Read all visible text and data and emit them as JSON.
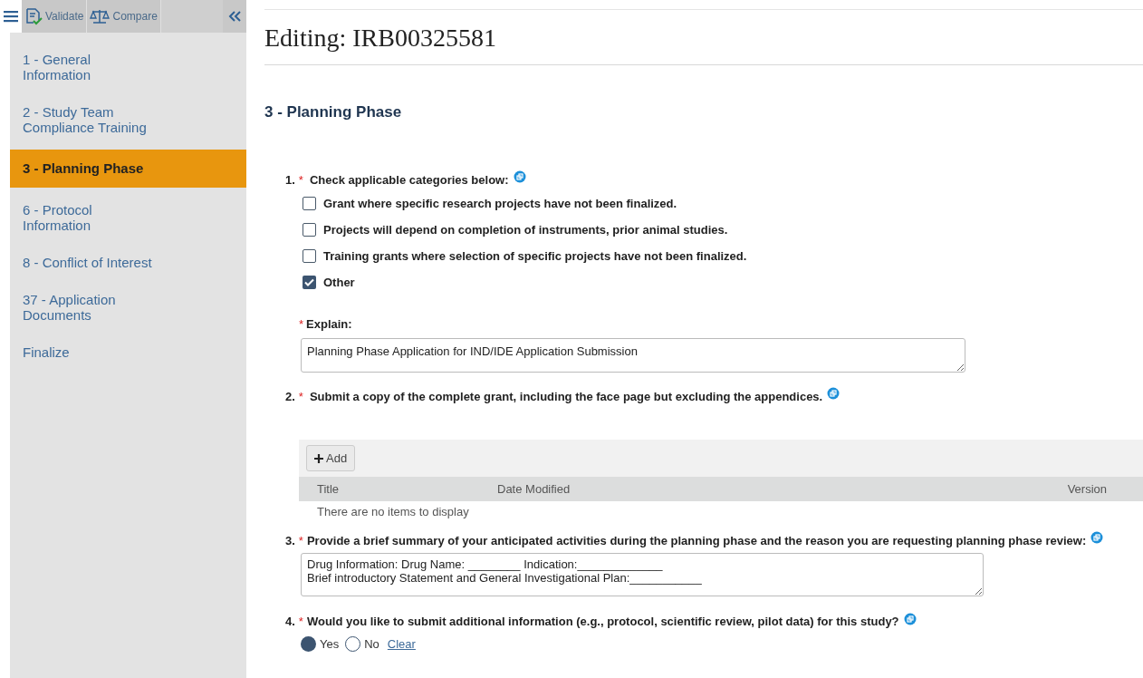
{
  "toolbar": {
    "buttons": [
      {
        "kind": "validate",
        "label": "Validate"
      },
      {
        "kind": "compare",
        "label": "Compare"
      }
    ]
  },
  "sidebar": {
    "items": [
      {
        "label": "1 - General Information",
        "selected": false
      },
      {
        "label": "2 - Study Team Compliance Training",
        "selected": false
      },
      {
        "label": "3 - Planning Phase",
        "selected": true
      },
      {
        "label": "6 - Protocol Information",
        "selected": false
      },
      {
        "label": "8 - Conflict of Interest",
        "selected": false
      },
      {
        "label": "37 - Application Documents",
        "selected": false
      },
      {
        "label": "Finalize",
        "selected": false
      }
    ]
  },
  "page_title": "Editing: IRB00325581",
  "section_title": "3 - Planning Phase",
  "q1": {
    "number": "1.",
    "required": "*",
    "label": "Check applicable categories below:",
    "options": [
      {
        "label": "Grant where specific research projects have not been finalized.",
        "checked": false
      },
      {
        "label": "Projects will depend on completion of instruments, prior animal studies.",
        "checked": false
      },
      {
        "label": "Training grants where selection of specific projects have not been finalized.",
        "checked": false
      },
      {
        "label": "Other",
        "checked": true
      }
    ],
    "explain_required": "*",
    "explain_label": "Explain:",
    "explain_value": "Planning Phase Application for IND/IDE Application Submission"
  },
  "q2": {
    "number": "2.",
    "required": "*",
    "label": "Submit a copy of the complete grant, including the face page but excluding the appendices.",
    "add_button": "Add",
    "columns": [
      "Title",
      "Date Modified",
      "Version"
    ],
    "empty_text": "There are no items to display"
  },
  "q3": {
    "number": "3.",
    "required": "*",
    "label": "Provide a brief summary of your anticipated activities during the planning phase and the reason you are requesting planning phase review:",
    "value": "Drug Information: Drug Name: ________ Indication:_____________\nBrief introductory Statement and General Investigational Plan:___________"
  },
  "q4": {
    "number": "4.",
    "required": "*",
    "label": "Would you like to submit additional information (e.g., protocol, scientific review, pilot data) for this study?",
    "options": [
      {
        "label": "Yes",
        "selected": true
      },
      {
        "label": "No",
        "selected": false
      }
    ],
    "clear_link": "Clear"
  }
}
